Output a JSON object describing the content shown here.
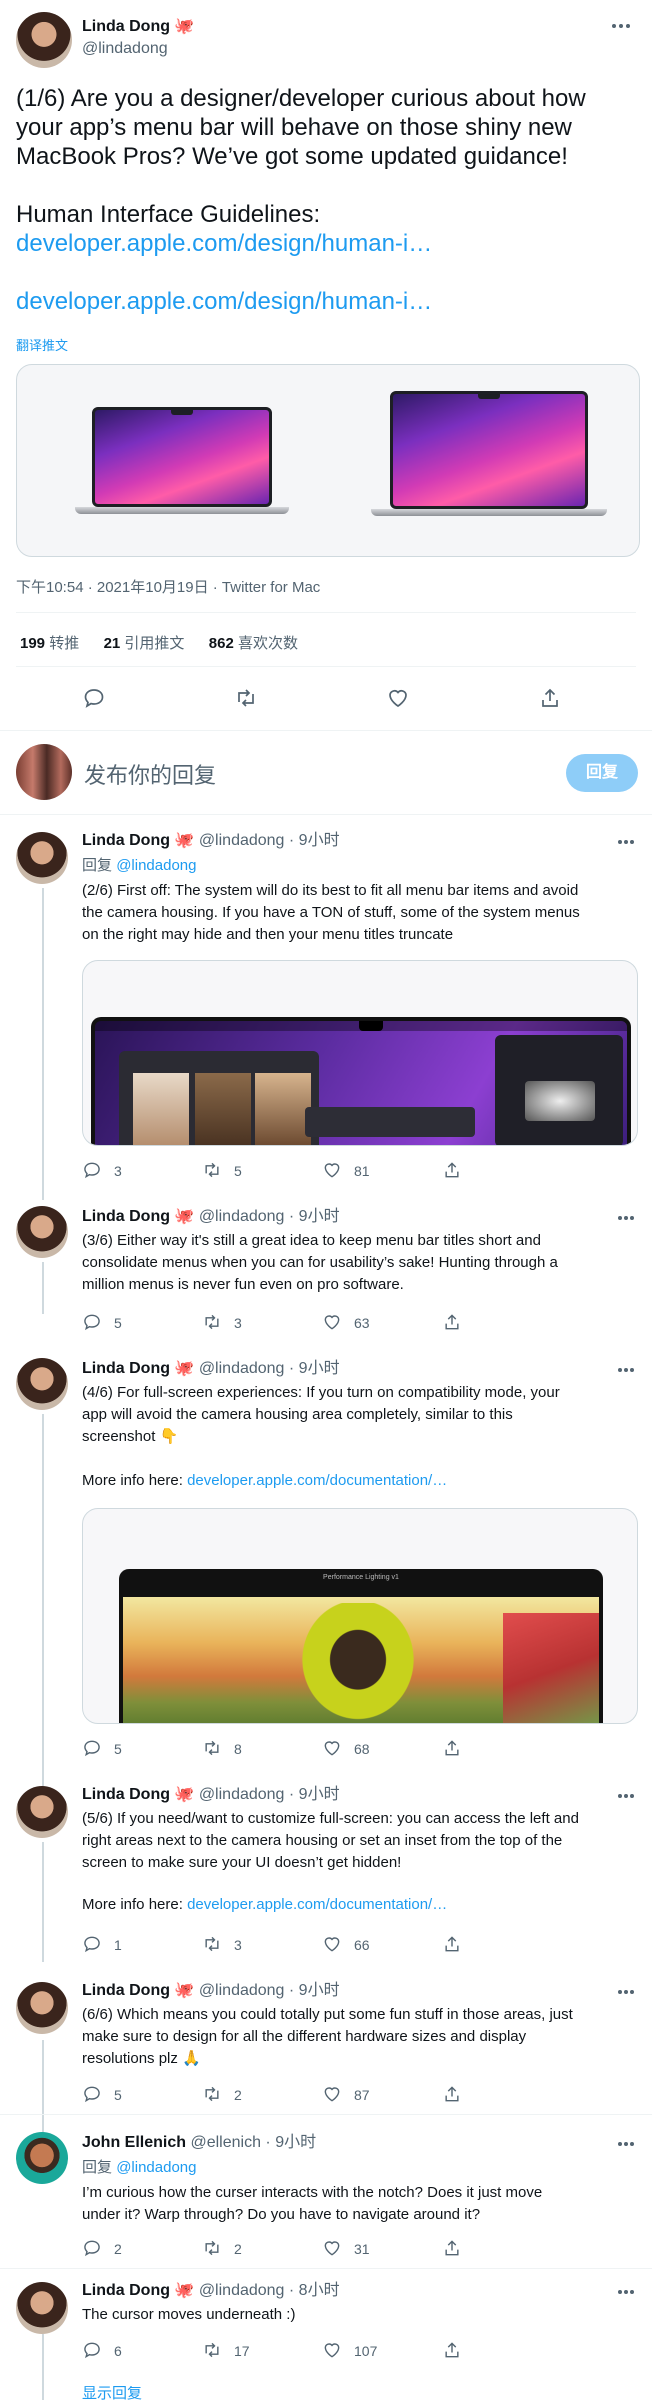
{
  "main_tweet": {
    "name": "Linda Dong 🐙",
    "handle": "@lindadong",
    "lines": [
      "(1/6) Are you a designer/developer curious about how",
      "your app’s menu bar will behave on those shiny new",
      "MacBook Pros? We’ve got some updated guidance!"
    ],
    "hig_label": "Human Interface Guidelines:",
    "link1": "developer.apple.com/design/human-i…",
    "link2": "developer.apple.com/design/human-i…",
    "translate": "翻译推文",
    "meta": "下午10:54 · 2021年10月19日 · Twitter for Mac",
    "stats": {
      "retweets": "199",
      "retweets_label": "转推",
      "quotes": "21",
      "quotes_label": "引用推文",
      "likes": "862",
      "likes_label": "喜欢次数"
    }
  },
  "compose": {
    "placeholder": "发布你的回复",
    "button": "回复"
  },
  "replies": [
    {
      "name": "Linda Dong 🐙",
      "handle": "@lindadong",
      "time": "· 9小时",
      "reply_label": "回复",
      "reply_to": "@lindadong",
      "lines": [
        "(2/6) First off: The system will do its best to fit all menu bar items and avoid",
        "the camera housing. If you have a TON of stuff, some of the system menus",
        "on the right may hide and then your menu titles truncate"
      ],
      "counts": {
        "reply": "3",
        "retweet": "5",
        "like": "81"
      }
    },
    {
      "name": "Linda Dong 🐙",
      "handle": "@lindadong",
      "time": "· 9小时",
      "lines": [
        "(3/6) Either way it's still a great idea to keep menu bar titles short and",
        "consolidate menus when you can for usability’s sake! Hunting through a",
        "million menus is never fun even on pro software."
      ],
      "counts": {
        "reply": "5",
        "retweet": "3",
        "like": "63"
      }
    },
    {
      "name": "Linda Dong 🐙",
      "handle": "@lindadong",
      "time": "· 9小时",
      "lines": [
        "(4/6) For full-screen experiences: If you turn on compatibility mode, your",
        "app will avoid the camera housing area completely, similar to this",
        "screenshot 👇"
      ],
      "more_info": "More info here:",
      "link": "developer.apple.com/documentation/…",
      "media_title": "Performance Lighting v1",
      "counts": {
        "reply": "5",
        "retweet": "8",
        "like": "68"
      }
    },
    {
      "name": "Linda Dong 🐙",
      "handle": "@lindadong",
      "time": "· 9小时",
      "lines": [
        "(5/6) If you need/want to customize full-screen: you can access the left and",
        "right areas next to the camera housing or set an inset from the top of the",
        "screen to make sure your UI doesn’t get hidden!"
      ],
      "more_info": "More info here:",
      "link": "developer.apple.com/documentation/…",
      "counts": {
        "reply": "1",
        "retweet": "3",
        "like": "66"
      }
    },
    {
      "name": "Linda Dong 🐙",
      "handle": "@lindadong",
      "time": "· 9小时",
      "lines": [
        "(6/6) Which means you could totally put some fun stuff in those areas, just",
        "make sure to design for all the different hardware sizes and display",
        "resolutions plz 🙏"
      ],
      "counts": {
        "reply": "5",
        "retweet": "2",
        "like": "87"
      }
    },
    {
      "name": "John Ellenich",
      "handle": "@ellenich",
      "time": "· 9小时",
      "reply_label": "回复",
      "reply_to": "@lindadong",
      "lines": [
        "I’m curious how the curser interacts with the notch? Does it just move",
        "under it? Warp through? Do you have to navigate around it?"
      ],
      "counts": {
        "reply": "2",
        "retweet": "2",
        "like": "31"
      }
    },
    {
      "name": "Linda Dong 🐙",
      "handle": "@lindadong",
      "time": "· 8小时",
      "lines": [
        "The cursor moves underneath :)"
      ],
      "counts": {
        "reply": "6",
        "retweet": "17",
        "like": "107"
      }
    }
  ],
  "show_replies": "显示回复",
  "colors": {
    "accent": "#1d9bf0",
    "secondary_text": "#536471",
    "border": "#cfd9de"
  }
}
